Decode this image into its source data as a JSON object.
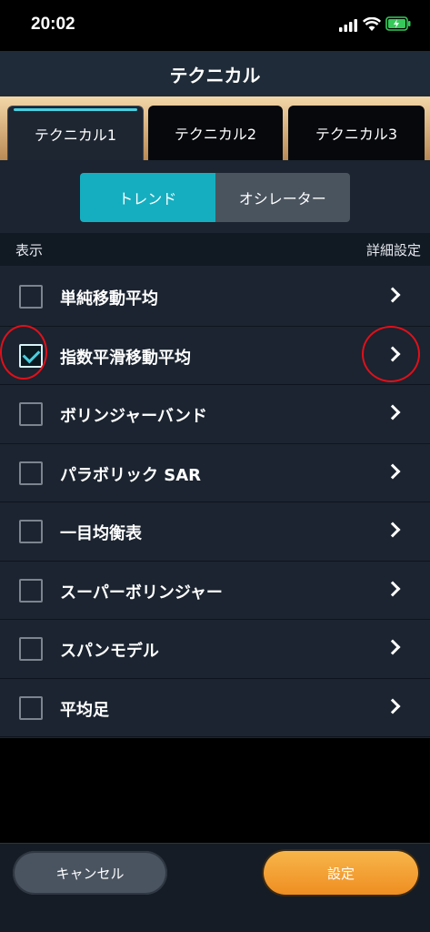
{
  "status_bar": {
    "time": "20:02",
    "icons": [
      "signal-icon",
      "wifi-icon",
      "battery-charging-icon"
    ]
  },
  "header": {
    "title": "テクニカル"
  },
  "tabs": [
    {
      "label": "テクニカル1",
      "selected": true
    },
    {
      "label": "テクニカル2",
      "selected": false
    },
    {
      "label": "テクニカル3",
      "selected": false
    }
  ],
  "segment": {
    "trend": "トレンド",
    "oscillator": "オシレーター",
    "selected": "trend"
  },
  "list_header": {
    "show": "表示",
    "detail": "詳細設定"
  },
  "indicators": [
    {
      "label": "単純移動平均",
      "checked": false
    },
    {
      "label": "指数平滑移動平均",
      "checked": true
    },
    {
      "label": "ボリンジャーバンド",
      "checked": false
    },
    {
      "label": "パラボリック SAR",
      "checked": false
    },
    {
      "label": "一目均衡表",
      "checked": false
    },
    {
      "label": "スーパーボリンジャー",
      "checked": false
    },
    {
      "label": "スパンモデル",
      "checked": false
    },
    {
      "label": "平均足",
      "checked": false
    }
  ],
  "footer": {
    "cancel": "キャンセル",
    "apply": "設定"
  },
  "colors": {
    "accent": "#15aec0",
    "header_bg": "#1f2b38",
    "content_bg": "#1b2430",
    "apply_button": "#f4a236",
    "annotation": "#e0101a"
  }
}
